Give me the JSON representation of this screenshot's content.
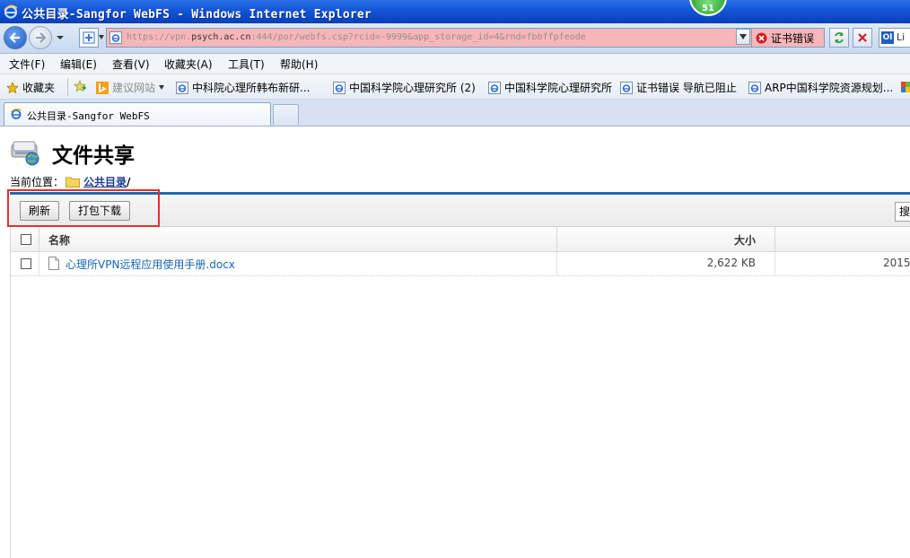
{
  "window": {
    "title": "公共目录-Sangfor WebFS - Windows Internet Explorer",
    "badge": "51"
  },
  "address_bar": {
    "url_prefix": "https://vpn.",
    "url_host": "psych.ac.cn",
    "url_rest": ":444/por/webfs.csp?rcid=-9999&app_storage_id=4&rnd=fbbffpfeode",
    "cert_error": "证书错误",
    "search_label": "Li",
    "search_icon_text": "Ol",
    "url_bg_color": "#f7b6b9"
  },
  "menu": {
    "items": [
      "文件(F)",
      "编辑(E)",
      "查看(V)",
      "收藏夹(A)",
      "工具(T)",
      "帮助(H)"
    ]
  },
  "favorites": {
    "label": "收藏夹",
    "suggested": "建议网站",
    "items": [
      "中科院心理所韩布新研...",
      "中国科学院心理研究所 (2)",
      "中国科学院心理研究所",
      "证书错误 导航已阻止",
      "ARP中国科学院资源规划..."
    ]
  },
  "tabs": {
    "active": "公共目录-Sangfor WebFS"
  },
  "page": {
    "title": "文件共享",
    "location_label": "当前位置：",
    "location_link": "公共目录",
    "location_slash": "/",
    "accent_color": "#1f6ab3",
    "highlight_color": "#e23030"
  },
  "toolbar": {
    "refresh_label": "刷新",
    "pack_download_label": "打包下载",
    "search_partial": "搜"
  },
  "table": {
    "columns": {
      "name": "名称",
      "size": "大小"
    },
    "rows": [
      {
        "name": "心理所VPN远程应用使用手册.docx",
        "size": "2,622 KB",
        "date": "2015"
      }
    ]
  }
}
